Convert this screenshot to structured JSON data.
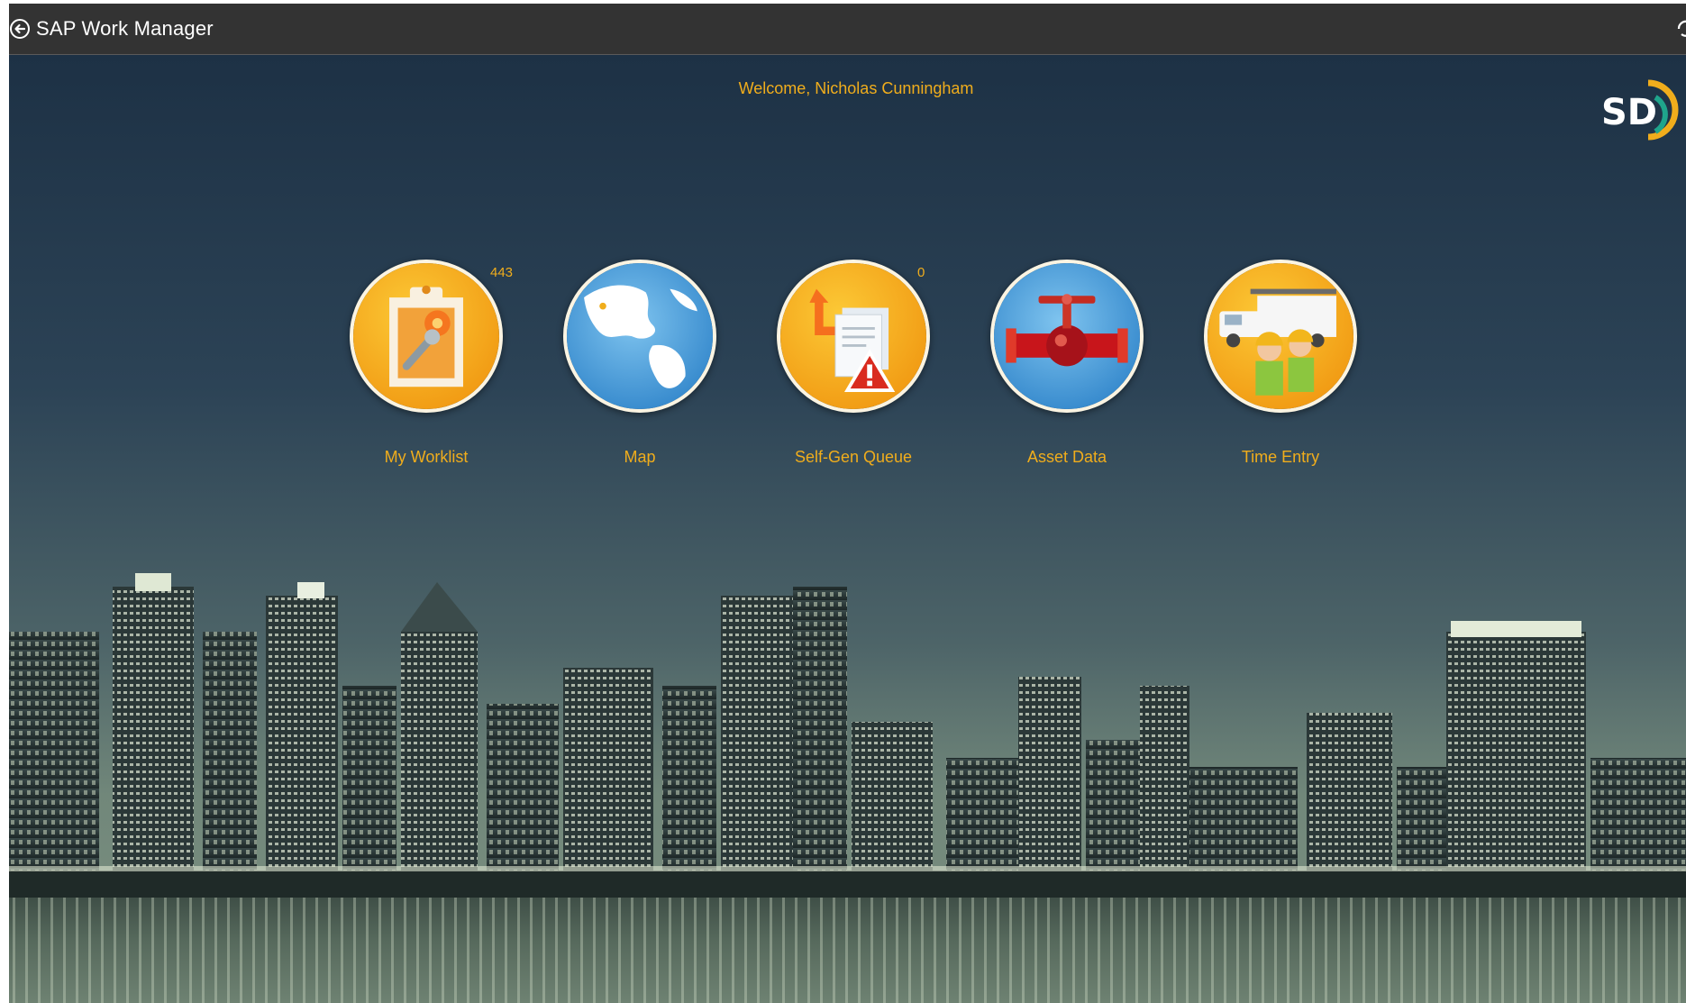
{
  "header": {
    "title": "SAP Work Manager",
    "back_icon": "back-arrow-circle-icon",
    "refresh_icon": "refresh-icon"
  },
  "welcome": "Welcome, Nicholas Cunningham",
  "logo": {
    "text": "SD",
    "icon": "sdge-logo"
  },
  "tiles": [
    {
      "label": "My Worklist",
      "badge": "443",
      "icon": "clipboard-wrench-icon"
    },
    {
      "label": "Map",
      "badge": "",
      "icon": "globe-icon"
    },
    {
      "label": "Self-Gen Queue",
      "badge": "0",
      "icon": "document-warning-icon"
    },
    {
      "label": "Asset Data",
      "badge": "",
      "icon": "pipe-valve-icon"
    },
    {
      "label": "Time Entry",
      "badge": "",
      "icon": "truck-workers-icon"
    }
  ],
  "colors": {
    "accent": "#f0ad1c",
    "header_bg": "#333333",
    "sky_top": "#1e3246",
    "sky_bottom": "#6f8777"
  }
}
